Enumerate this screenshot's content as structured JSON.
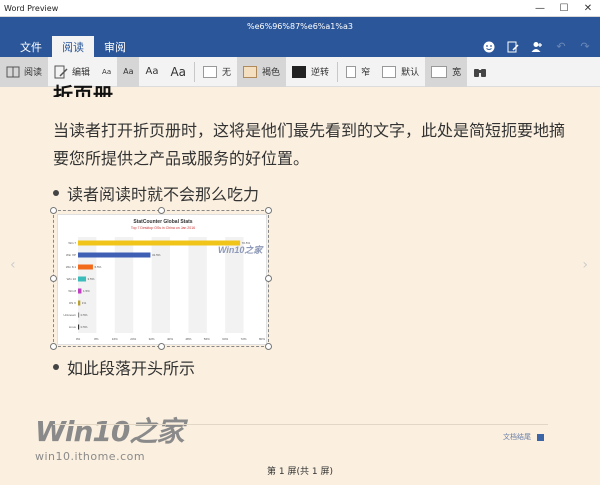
{
  "app": {
    "title": "Word Preview",
    "doc_title": "%e6%96%87%e6%a1%a3"
  },
  "window_controls": {
    "minimize": "—",
    "maximize": "☐",
    "close": "✕"
  },
  "tabs": [
    {
      "label": "文件",
      "active": false
    },
    {
      "label": "阅读",
      "active": true
    },
    {
      "label": "审阅",
      "active": false
    }
  ],
  "right_commands": [
    "smiley-icon",
    "edit-doc-icon",
    "add-user-icon",
    "undo-icon",
    "redo-icon"
  ],
  "toolbar": {
    "read_label": "阅读",
    "edit_label": "编辑",
    "font_sizes": [
      "Aa",
      "Aa",
      "Aa",
      "Aa"
    ],
    "theme_none": "无",
    "theme_brown": "褐色",
    "theme_invert": "逆转",
    "width_narrow": "窄",
    "width_default": "默认",
    "width_wide": "宽"
  },
  "document": {
    "heading": "折页册",
    "paragraph": "当读者打开折页册时，这将是他们最先看到的文字，此处是简短扼要地摘要您所提供之产品或服务的好位置。",
    "bullet1": "读者阅读时就不会那么吃力",
    "bullet2": "如此段落开头所示",
    "end_label": "文档结尾",
    "page_info": "第 1 屏(共 1 屏)"
  },
  "chart_data": {
    "type": "bar",
    "title": "StatCounter Global Stats",
    "subtitle": "Top 7 Desktop OSs in China on Jan 2016",
    "categories": [
      "Win 7",
      "Win XP",
      "Win 8.1",
      "Win 10",
      "Win 8",
      "OS X",
      "Unknown",
      "Linux"
    ],
    "values": [
      70.5,
      31.5,
      6.5,
      3.5,
      1.5,
      1.0,
      0.5,
      0.5
    ],
    "colors": [
      "#f0c419",
      "#3f5fb5",
      "#f26b1d",
      "#3dbcbc",
      "#c03fc0",
      "#b8a030",
      "#888888",
      "#333333"
    ],
    "xlim": [
      0,
      80
    ],
    "xticks": [
      "0%",
      "8%",
      "16%",
      "24%",
      "32%",
      "40%",
      "48%",
      "56%",
      "64%",
      "72%",
      "80%"
    ],
    "watermark": "Win10之家"
  },
  "watermark": {
    "big": "Win10之家",
    "small": "win10.ithome.com"
  }
}
